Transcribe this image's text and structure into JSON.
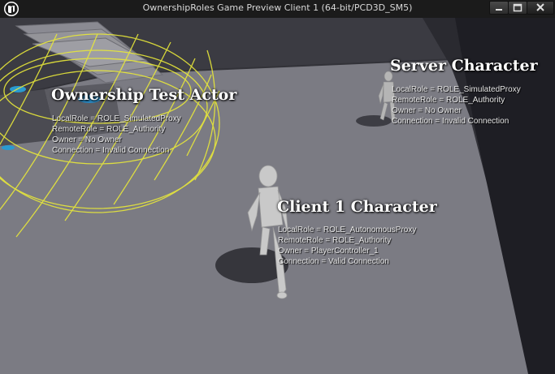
{
  "window": {
    "title": "OwnershipRoles Game Preview Client 1 (64-bit/PCD3D_SM5)",
    "logo_icon": "unreal-logo-icon",
    "buttons": [
      "minimize-icon",
      "maximize-icon",
      "close-icon"
    ]
  },
  "labels": [
    {
      "name": "ownership-test-actor",
      "title": "Ownership Test Actor",
      "lines": [
        "LocalRole = ROLE_SimulatedProxy",
        "RemoteRole = ROLE_Authority",
        "Owner = No Owner",
        "Connection = Invalid Connection"
      ]
    },
    {
      "name": "server-character",
      "title": "Server Character",
      "lines": [
        "LocalRole = ROLE_SimulatedProxy",
        "RemoteRole = ROLE_Authority",
        "Owner = No Owner",
        "Connection = Invalid Connection"
      ]
    },
    {
      "name": "client-1-character",
      "title": "Client 1 Character",
      "lines": [
        "LocalRole = ROLE_AutonomousProxy",
        "RemoteRole = ROLE_Authority",
        "Owner = PlayerController_1",
        "Connection = Valid Connection"
      ]
    }
  ],
  "colors": {
    "floor": "#7b7b83",
    "wall": "#1e1e24",
    "debug_sphere": "#e8e83a",
    "titlebar": "#1b1b1b"
  }
}
